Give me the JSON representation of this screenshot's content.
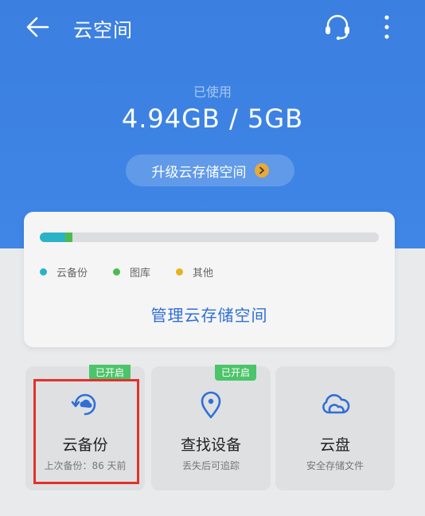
{
  "header": {
    "title": "云空间",
    "used_label": "已使用",
    "used_value": "4.94GB / 5GB",
    "upgrade_label": "升级云存储空间"
  },
  "storage": {
    "usage": [
      {
        "name": "云备份",
        "fraction": 0.075,
        "color": "#2ab3c7"
      },
      {
        "name": "图库",
        "fraction": 0.022,
        "color": "#4cbb4f"
      },
      {
        "name": "其他",
        "fraction": 0.0,
        "color": "#e7b21f"
      }
    ],
    "legend": [
      "云备份",
      "图库",
      "其他"
    ],
    "manage_label": "管理云存储空间"
  },
  "tiles": [
    {
      "title": "云备份",
      "subtitle": "上次备份：86 天前",
      "badge": "已开启",
      "icon": "cloud-backup-icon"
    },
    {
      "title": "查找设备",
      "subtitle": "丢失后可追踪",
      "badge": "已开启",
      "icon": "location-pin-icon"
    },
    {
      "title": "云盘",
      "subtitle": "安全存储文件",
      "badge": "",
      "icon": "cloud-drive-icon"
    }
  ],
  "colors": {
    "header_blue": "#3b7fe0",
    "link_blue": "#2f6fd6",
    "badge_green": "#4cc46a",
    "highlight_red": "#e0322c"
  }
}
